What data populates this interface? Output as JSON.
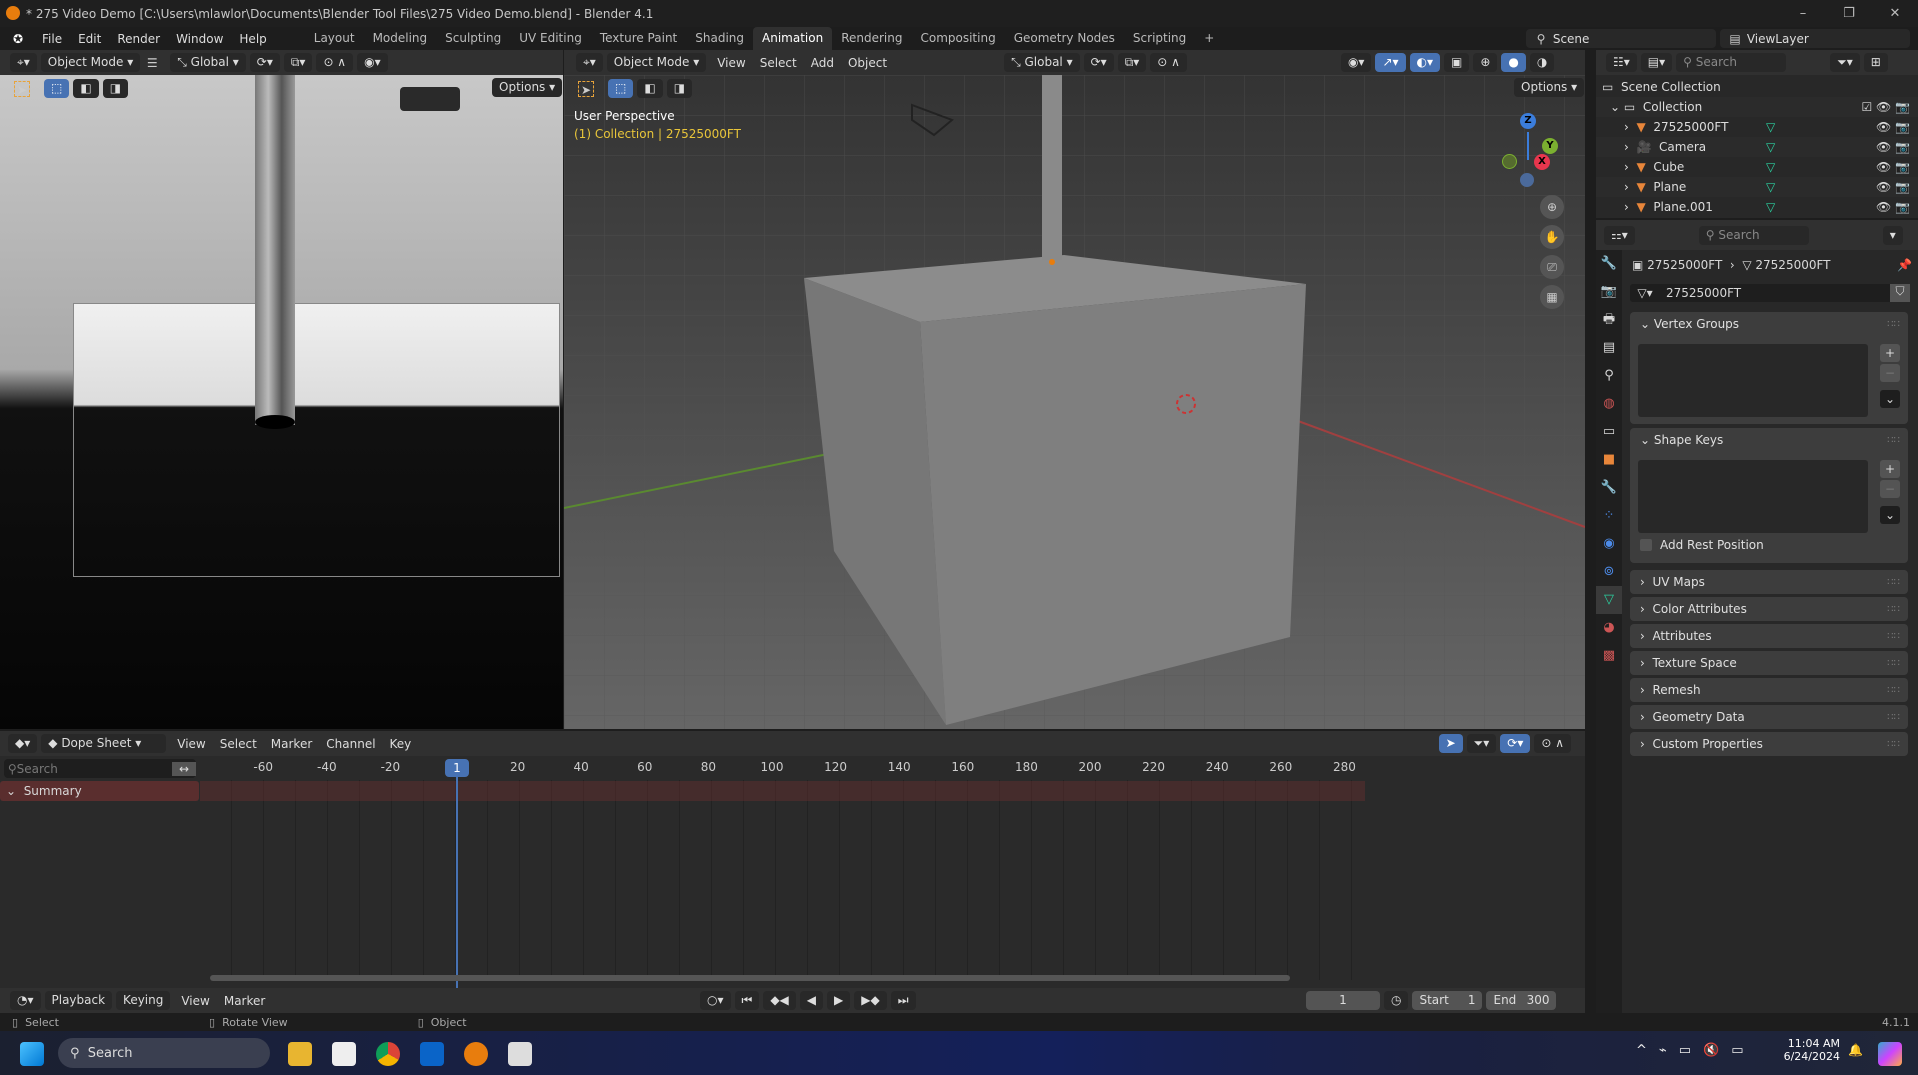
{
  "window": {
    "title": "* 275 Video Demo [C:\\Users\\mlawlor\\Documents\\Blender Tool Files\\275 Video Demo.blend] - Blender 4.1",
    "minimize": "–",
    "maximize": "❐",
    "close": "✕"
  },
  "menu": [
    "File",
    "Edit",
    "Render",
    "Window",
    "Help"
  ],
  "workspaces": [
    "Layout",
    "Modeling",
    "Sculpting",
    "UV Editing",
    "Texture Paint",
    "Shading",
    "Animation",
    "Rendering",
    "Compositing",
    "Geometry Nodes",
    "Scripting",
    "+"
  ],
  "active_workspace": "Animation",
  "scene": {
    "name": "Scene",
    "view_layer": "ViewLayer"
  },
  "camera_viewport": {
    "mode": "Object Mode",
    "orientation": "Global",
    "options": "Options"
  },
  "main_viewport": {
    "mode": "Object Mode",
    "menus": [
      "View",
      "Select",
      "Add",
      "Object"
    ],
    "orientation": "Global",
    "options": "Options",
    "overlay_title": "User Perspective",
    "overlay_sub": "(1) Collection | 27525000FT",
    "gizmo": {
      "z": "Z",
      "y": "Y",
      "x": "X"
    }
  },
  "outliner": {
    "search_placeholder": "Search",
    "scene_collection": "Scene Collection",
    "collection": "Collection",
    "items": [
      {
        "name": "27525000FT",
        "type": "mesh"
      },
      {
        "name": "Camera",
        "type": "camera"
      },
      {
        "name": "Cube",
        "type": "mesh"
      },
      {
        "name": "Plane",
        "type": "mesh"
      },
      {
        "name": "Plane.001",
        "type": "mesh"
      }
    ]
  },
  "properties": {
    "search_placeholder": "Search",
    "breadcrumb_object": "27525000FT",
    "breadcrumb_data": "27525000FT",
    "mesh_name": "27525000FT",
    "panels_open": [
      "Vertex Groups",
      "Shape Keys"
    ],
    "add_rest_position": "Add Rest Position",
    "add_rest_position_checked": false,
    "panels_closed": [
      "UV Maps",
      "Color Attributes",
      "Attributes",
      "Texture Space",
      "Remesh",
      "Geometry Data",
      "Custom Properties"
    ]
  },
  "dopesheet": {
    "mode": "Dope Sheet",
    "menus": [
      "View",
      "Select",
      "Marker",
      "Channel",
      "Key"
    ],
    "search_placeholder": "Search",
    "summary": "Summary",
    "current_frame": "1",
    "ticks": [
      "-60",
      "-40",
      "-20",
      "20",
      "40",
      "60",
      "80",
      "100",
      "120",
      "140",
      "160",
      "180",
      "200",
      "220",
      "240",
      "260",
      "280"
    ]
  },
  "timeline": {
    "menus": [
      "Playback",
      "Keying",
      "View",
      "Marker"
    ],
    "frame": "1",
    "start_label": "Start",
    "start": "1",
    "end_label": "End",
    "end": "300"
  },
  "status": {
    "select": "Select",
    "rotate": "Rotate View",
    "object": "Object",
    "version": "4.1.1"
  },
  "taskbar": {
    "search": "Search",
    "time": "11:04 AM",
    "date": "6/24/2024"
  },
  "colors": {
    "accent": "#4772b3",
    "active_text": "#e8c53a",
    "summary": "#5a2e2e"
  }
}
